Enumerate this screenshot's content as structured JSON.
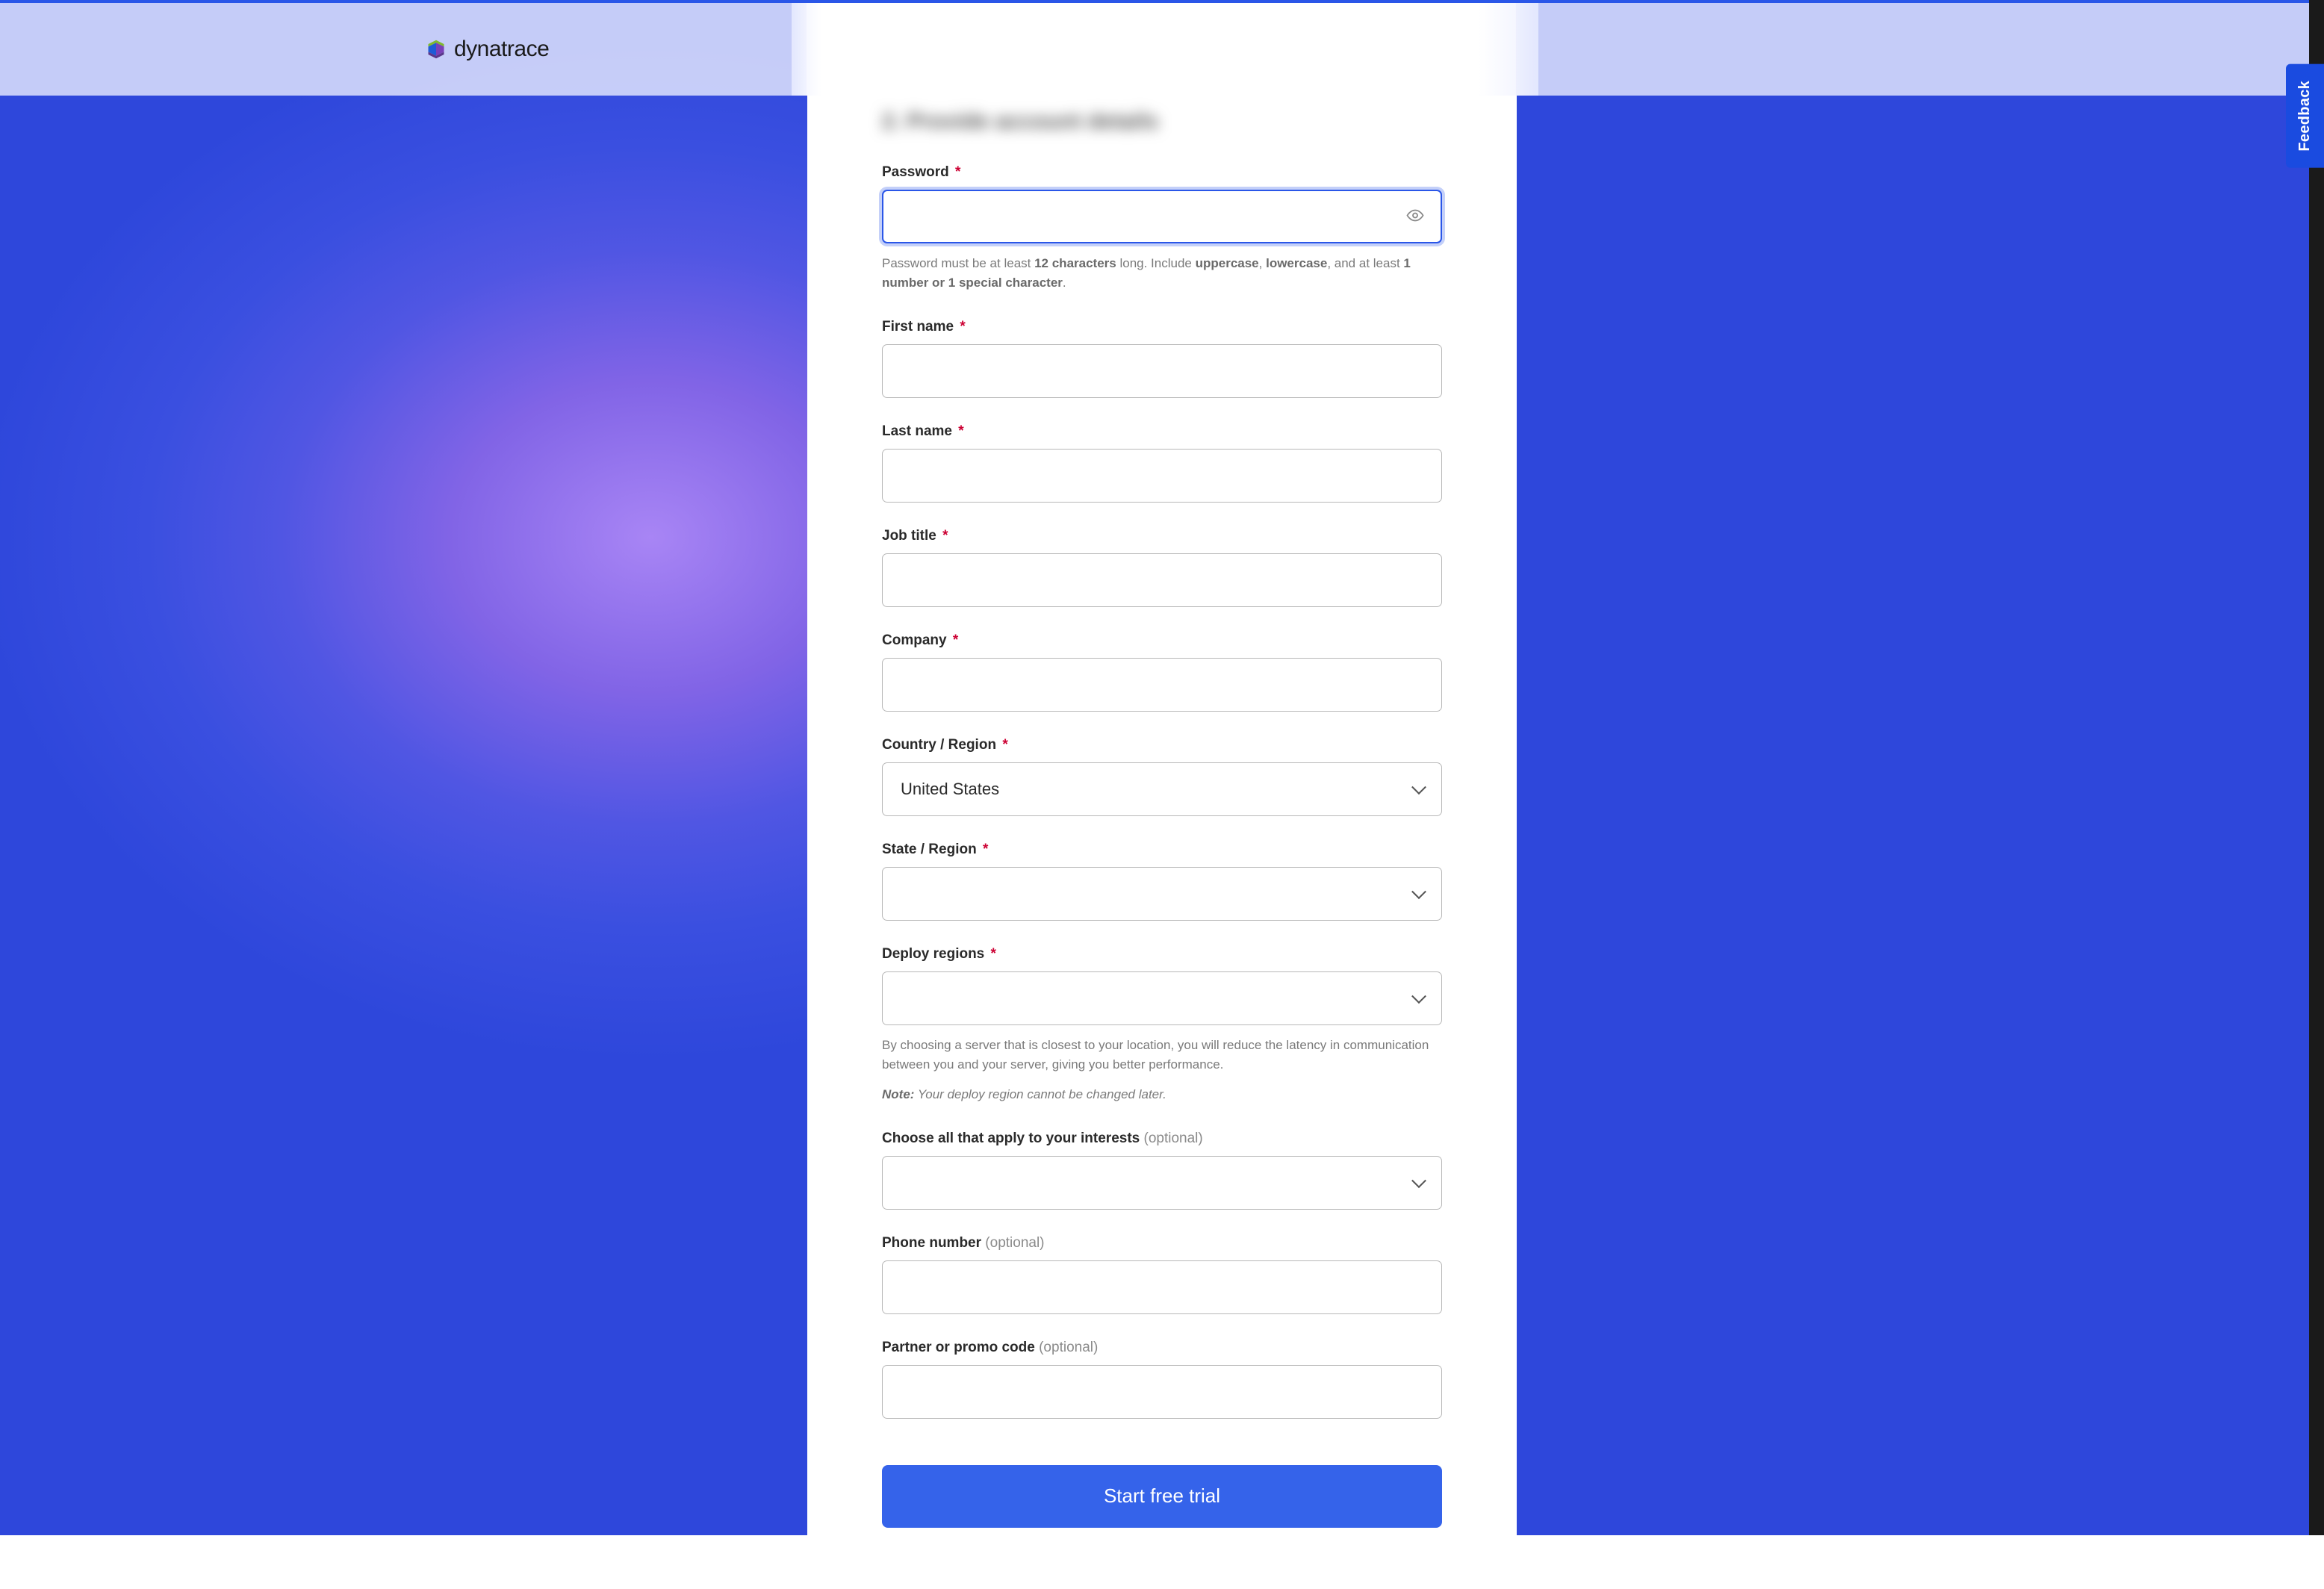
{
  "brand": {
    "name": "dynatrace"
  },
  "section": {
    "title_blurred": "2. Provide account details"
  },
  "form": {
    "password": {
      "label": "Password",
      "required": true,
      "value": "",
      "hint_parts": {
        "prefix": "Password must be at least ",
        "b1": "12 characters",
        "mid1": " long. Include ",
        "b2": "uppercase",
        "sep": ", ",
        "b3": "lowercase",
        "mid2": ", and at least ",
        "b4": "1 number or 1 special character",
        "suffix": "."
      }
    },
    "first_name": {
      "label": "First name",
      "required": true,
      "value": ""
    },
    "last_name": {
      "label": "Last name",
      "required": true,
      "value": ""
    },
    "job_title": {
      "label": "Job title",
      "required": true,
      "value": ""
    },
    "company": {
      "label": "Company",
      "required": true,
      "value": ""
    },
    "country": {
      "label": "Country / Region",
      "required": true,
      "value": "United States"
    },
    "state": {
      "label": "State / Region",
      "required": true,
      "value": ""
    },
    "deploy_regions": {
      "label": "Deploy regions",
      "required": true,
      "value": "",
      "hint": "By choosing a server that is closest to your location, you will reduce the latency in communication between you and your server, giving you better performance.",
      "note_label": "Note:",
      "note_text": " Your deploy region cannot be changed later."
    },
    "interests": {
      "label": "Choose all that apply to your interests",
      "optional_text": "(optional)",
      "value": ""
    },
    "phone": {
      "label": "Phone number",
      "optional_text": "(optional)",
      "value": ""
    },
    "promo": {
      "label": "Partner or promo code",
      "optional_text": "(optional)",
      "value": ""
    }
  },
  "submit": {
    "label": "Start free trial"
  },
  "feedback": {
    "label": "Feedback"
  }
}
